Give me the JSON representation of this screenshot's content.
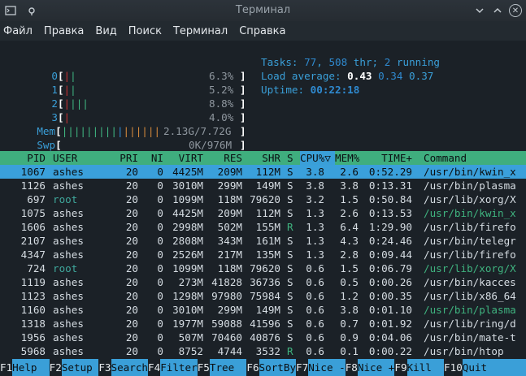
{
  "window": {
    "title": "Терминал"
  },
  "menu": [
    "Файл",
    "Правка",
    "Вид",
    "Поиск",
    "Терминал",
    "Справка"
  ],
  "meters": {
    "cpus": [
      {
        "label": "0",
        "pct": "6.3%"
      },
      {
        "label": "1",
        "pct": "5.2%"
      },
      {
        "label": "2",
        "pct": "8.8%"
      },
      {
        "label": "3",
        "pct": "4.0%"
      }
    ],
    "mem": {
      "label": "Mem",
      "value": "2.13G/7.72G"
    },
    "swp": {
      "label": "Swp",
      "value": "0K/976M"
    }
  },
  "summary": {
    "tasks_label": "Tasks:",
    "tasks": "77",
    "thr": "508",
    "thr_label": "thr;",
    "running": "2",
    "running_label": "running",
    "load_label": "Load average:",
    "load1": "0.43",
    "load5": "0.34",
    "load15": "0.37",
    "uptime_label": "Uptime:",
    "uptime": "00:22:18"
  },
  "table": {
    "headers": [
      "PID",
      "USER",
      "PRI",
      "NI",
      "VIRT",
      "RES",
      "SHR",
      "S",
      "CPU%▽",
      "MEM%",
      "TIME+",
      "Command"
    ],
    "rows": [
      [
        "1067",
        "ashes",
        "20",
        "0",
        "4425M",
        "209M",
        "112M",
        "S",
        "3.8",
        "2.6",
        "0:52.29",
        "/usr/bin/kwin_x"
      ],
      [
        "1126",
        "ashes",
        "20",
        "0",
        "3010M",
        "299M",
        "149M",
        "S",
        "3.8",
        "3.8",
        "0:13.31",
        "/usr/bin/plasma"
      ],
      [
        "697",
        "root",
        "20",
        "0",
        "1099M",
        "118M",
        "79620",
        "S",
        "3.2",
        "1.5",
        "0:50.84",
        "/usr/lib/xorg/X"
      ],
      [
        "1075",
        "ashes",
        "20",
        "0",
        "4425M",
        "209M",
        "112M",
        "S",
        "1.3",
        "2.6",
        "0:13.53",
        "/usr/bin/kwin_x"
      ],
      [
        "1606",
        "ashes",
        "20",
        "0",
        "2998M",
        "502M",
        "155M",
        "R",
        "1.3",
        "6.4",
        "1:29.90",
        "/usr/lib/firefo"
      ],
      [
        "2107",
        "ashes",
        "20",
        "0",
        "2808M",
        "343M",
        "161M",
        "S",
        "1.3",
        "4.3",
        "0:24.46",
        "/usr/bin/telegr"
      ],
      [
        "4347",
        "ashes",
        "20",
        "0",
        "2526M",
        "217M",
        "135M",
        "S",
        "1.3",
        "2.8",
        "0:09.44",
        "/usr/lib/firefo"
      ],
      [
        "724",
        "root",
        "20",
        "0",
        "1099M",
        "118M",
        "79620",
        "S",
        "0.6",
        "1.5",
        "0:06.79",
        "/usr/lib/xorg/X"
      ],
      [
        "1119",
        "ashes",
        "20",
        "0",
        "273M",
        "41828",
        "36736",
        "S",
        "0.6",
        "0.5",
        "0:00.26",
        "/usr/bin/kacces"
      ],
      [
        "1123",
        "ashes",
        "20",
        "0",
        "1298M",
        "97980",
        "75984",
        "S",
        "0.6",
        "1.2",
        "0:00.35",
        "/usr/lib/x86_64"
      ],
      [
        "1160",
        "ashes",
        "20",
        "0",
        "3010M",
        "299M",
        "149M",
        "S",
        "0.6",
        "3.8",
        "0:01.10",
        "/usr/bin/plasma"
      ],
      [
        "1318",
        "ashes",
        "20",
        "0",
        "1977M",
        "59088",
        "41596",
        "S",
        "0.6",
        "0.7",
        "0:01.92",
        "/usr/lib/ring/d"
      ],
      [
        "1956",
        "ashes",
        "20",
        "0",
        "507M",
        "70460",
        "40876",
        "S",
        "0.6",
        "0.9",
        "0:04.06",
        "/usr/bin/mate-t"
      ],
      [
        "5968",
        "ashes",
        "20",
        "0",
        "8752",
        "4744",
        "3532",
        "R",
        "0.6",
        "0.1",
        "0:00.22",
        "/usr/bin/htop"
      ]
    ]
  },
  "fkeys": [
    {
      "key": "F1",
      "label": "Help  "
    },
    {
      "key": "F2",
      "label": "Setup "
    },
    {
      "key": "F3",
      "label": "Search"
    },
    {
      "key": "F4",
      "label": "Filter"
    },
    {
      "key": "F5",
      "label": "Tree  "
    },
    {
      "key": "F6",
      "label": "SortBy"
    },
    {
      "key": "F7",
      "label": "Nice -"
    },
    {
      "key": "F8",
      "label": "Nice +"
    },
    {
      "key": "F9",
      "label": "Kill  "
    },
    {
      "key": "F10",
      "label": "Quit"
    }
  ],
  "colors": {
    "header_bg": "#3fae7e",
    "selected_bg": "#3aa0db",
    "thread_row": "#3fb37f"
  }
}
